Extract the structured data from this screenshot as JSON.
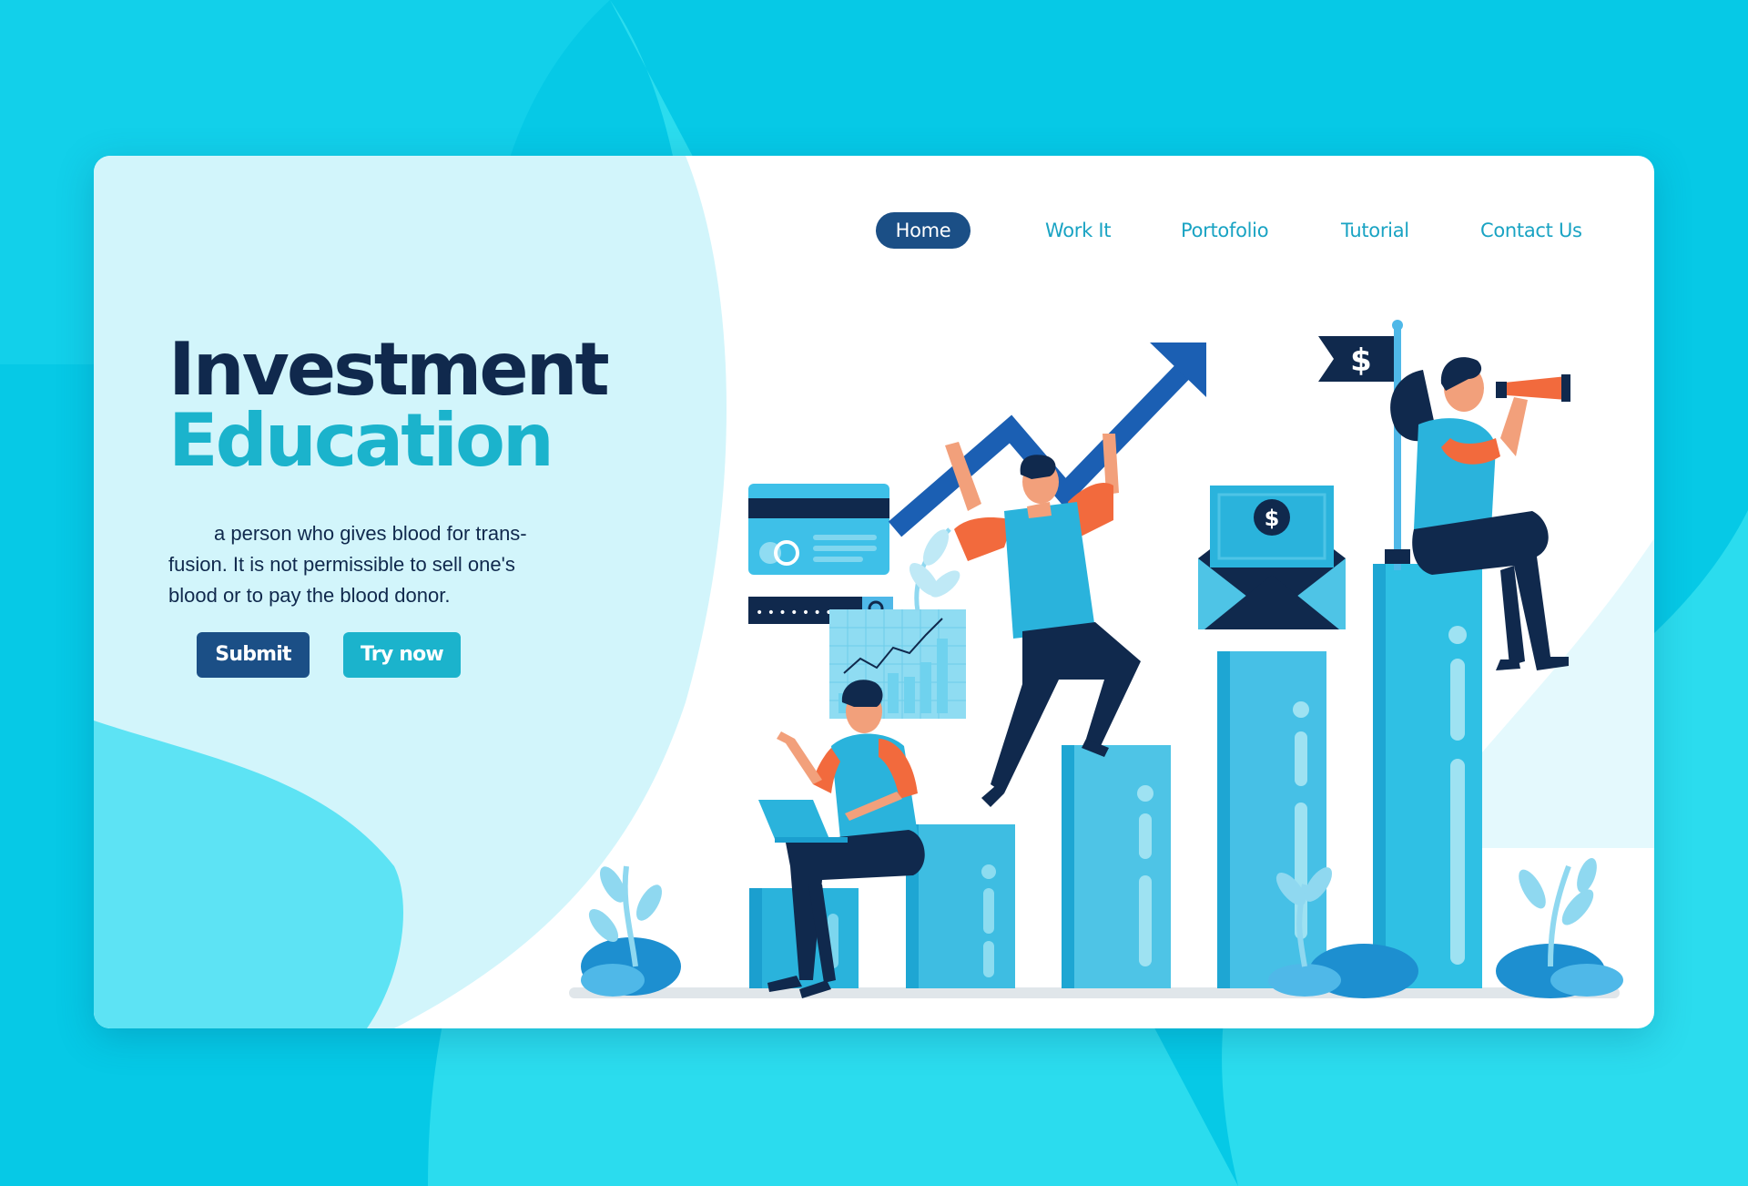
{
  "nav": {
    "items": [
      {
        "label": "Home",
        "active": true
      },
      {
        "label": "Work It",
        "active": false
      },
      {
        "label": "Portofolio",
        "active": false
      },
      {
        "label": "Tutorial",
        "active": false
      },
      {
        "label": "Contact Us",
        "active": false
      }
    ]
  },
  "hero": {
    "title_line1": "Investment",
    "title_line2": "Education",
    "description": "a person who gives blood for trans- fusion. It is not permissible to sell one's blood or to pay the blood donor.",
    "submit_label": "Submit",
    "try_label": "Try now"
  },
  "illustration": {
    "flag_symbol": "$",
    "envelope_symbol": "$",
    "card_search_dots": "• • • • • • •",
    "icons": [
      "growth-arrow-icon",
      "credit-card-icon",
      "search-icon",
      "mini-bar-chart-icon",
      "money-envelope-icon",
      "dollar-flag-icon",
      "telescope-icon",
      "laptop-icon",
      "leaf-icon"
    ]
  },
  "colors": {
    "background": "#06c9e6",
    "navy": "#10294d",
    "button_dark": "#1b4f86",
    "accent": "#1bb3cc",
    "panel_light": "#d2f5fb",
    "orange": "#f26a3d"
  }
}
